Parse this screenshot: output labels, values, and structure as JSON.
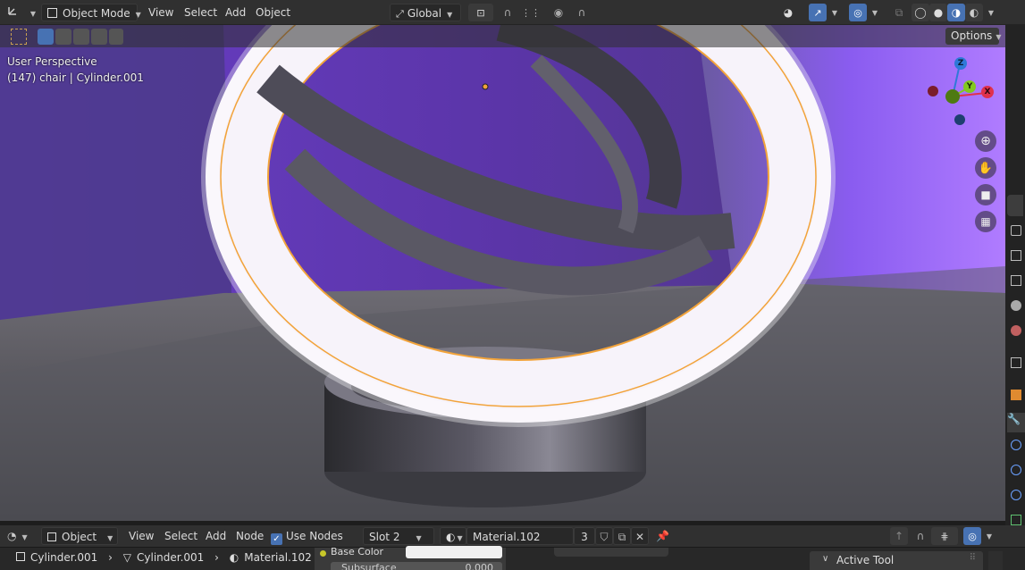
{
  "header": {
    "mode": "Object Mode",
    "menus": [
      "View",
      "Select",
      "Add",
      "Object"
    ],
    "transform_orientation": "Global"
  },
  "toolbar": {
    "options_label": "Options"
  },
  "viewport": {
    "perspective_label": "User Perspective",
    "object_label": "(147) chair  | Cylinder.001",
    "gizmo": {
      "z": "Z",
      "y": "Y",
      "x": "X"
    }
  },
  "node_editor": {
    "mode": "Object",
    "menus": [
      "View",
      "Select",
      "Add",
      "Node"
    ],
    "use_nodes_label": "Use Nodes",
    "use_nodes_checked": true,
    "slot": "Slot 2",
    "material": "Material.102",
    "user_count": "3"
  },
  "breadcrumb": {
    "object": "Cylinder.001",
    "mesh": "Cylinder.001",
    "material": "Material.102"
  },
  "node_panel": {
    "base_color_label": "Base Color",
    "subsurface_label": "Subsurface",
    "subsurface_value": "0.000"
  },
  "properties": {
    "active_tool_label": "Active Tool"
  },
  "colors": {
    "accent_blue": "#4772b3",
    "selection_orange": "#f2a33a",
    "axis_x": "#e0314d",
    "axis_y": "#82c91e",
    "axis_z": "#2f79d8"
  }
}
